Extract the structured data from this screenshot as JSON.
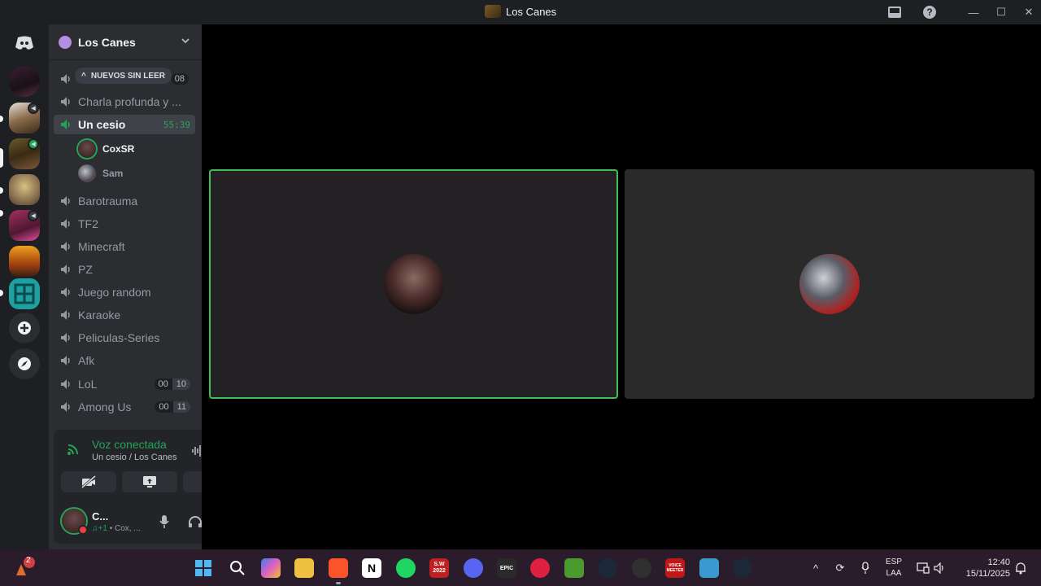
{
  "window": {
    "title": "Los Canes"
  },
  "server": {
    "name": "Los Canes"
  },
  "sidebar": {
    "new_unreads_pill": "NUEVOS SIN LEER",
    "channels": [
      {
        "name": "",
        "count_a": "",
        "count_b": "08"
      },
      {
        "name": "Charla profunda y ..."
      },
      {
        "name": "Un cesio",
        "timer": "55:39",
        "active": true
      },
      {
        "name": "Barotrauma"
      },
      {
        "name": "TF2"
      },
      {
        "name": "Minecraft"
      },
      {
        "name": "PZ"
      },
      {
        "name": "Juego random"
      },
      {
        "name": "Karaoke"
      },
      {
        "name": "Peliculas-Series"
      },
      {
        "name": "Afk"
      },
      {
        "name": "LoL",
        "count_a": "00",
        "count_b": "10"
      },
      {
        "name": "Among Us",
        "count_a": "00",
        "count_b": "11"
      }
    ],
    "voice_users": [
      {
        "name": "CoxSR",
        "speaking": true
      },
      {
        "name": "Sam",
        "speaking": false
      }
    ]
  },
  "voice_panel": {
    "title": "Voz conectada",
    "subtitle": "Un cesio / Los Canes"
  },
  "user_panel": {
    "name": "C...",
    "status_prefix": "♫+1",
    "status_text": "• Cox, ..."
  },
  "taskbar": {
    "notification_count": "2",
    "apps": [
      {
        "icon": "windows-start-icon",
        "label": ""
      },
      {
        "icon": "search-icon",
        "label": ""
      },
      {
        "icon": "copilot-icon",
        "label": ""
      },
      {
        "icon": "file-explorer-icon",
        "label": ""
      },
      {
        "icon": "brave-icon",
        "label": ""
      },
      {
        "icon": "notion-icon",
        "label": "N"
      },
      {
        "icon": "spotify-icon",
        "label": ""
      },
      {
        "icon": "sw-2022-icon",
        "label": "S.W 2022"
      },
      {
        "icon": "discord-icon",
        "label": ""
      },
      {
        "icon": "epic-games-icon",
        "label": "EPIC"
      },
      {
        "icon": "game-icon",
        "label": ""
      },
      {
        "icon": "minecraft-icon",
        "label": ""
      },
      {
        "icon": "steam-icon",
        "label": ""
      },
      {
        "icon": "obs-icon",
        "label": ""
      },
      {
        "icon": "voicemeeter-icon",
        "label": "VOICE MEETER"
      },
      {
        "icon": "app-icon",
        "label": ""
      },
      {
        "icon": "steam-icon",
        "label": ""
      }
    ],
    "lang_top": "ESP",
    "lang_bottom": "LAA",
    "time": "12:40",
    "date": "15/11/2025"
  },
  "colors": {
    "speaking_green": "#23a559",
    "tile_border": "#3fbf55",
    "dnd_red": "#f23f43"
  }
}
